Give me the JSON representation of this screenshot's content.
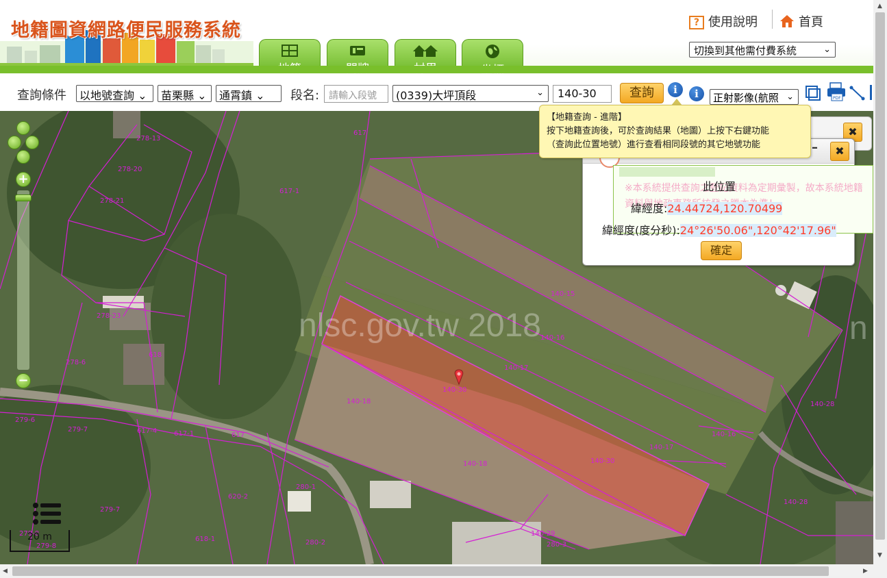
{
  "header": {
    "site_title": "地籍圖資網路便民服務系統",
    "help_label": "使用說明",
    "home_label": "首頁",
    "system_switch": "切換到其他需付費系統",
    "tabs": [
      {
        "label": "地籍",
        "icon": "parcel-grid-icon",
        "active": true
      },
      {
        "label": "門牌",
        "icon": "doorplate-icon",
        "active": false
      },
      {
        "label": "村里",
        "icon": "village-houses-icon",
        "active": false
      },
      {
        "label": "坐標",
        "icon": "globe-icon",
        "active": false
      }
    ]
  },
  "query": {
    "condition_label": "查詢條件",
    "mode": "以地號查詢",
    "county": "苗栗縣",
    "town": "通霄鎮",
    "section_label": "段名:",
    "section_placeholder": "請輸入段號",
    "section": "(0339)大坪頂段",
    "parcel_no": "140-30",
    "search_label": "查詢",
    "basemap": "正射影像(航照"
  },
  "tooltip": {
    "title": "【地籍查詢 - 進階】",
    "line1": "按下地籍查詢後，可於查詢結果（地圖）上按下右鍵功能",
    "line2": "（查詢此位置地號）進行查看相同段號的其它地號功能"
  },
  "position_popup": {
    "notice": "※本系統提供查詢之登記資料為定期彙製，故本系統地籍資料與地政事務所核發之謄本為準！",
    "title": "此位置",
    "latlon_label": "緯經度:",
    "latlon_value": "24.44724,120.70499",
    "dms_label": "緯經度(度分秒):",
    "dms_value": "24°26'50.06\",120°42'17.96\"",
    "confirm_label": "確定"
  },
  "map": {
    "watermark": "nlsc.gov.tw 2018",
    "watermark_tail": "n",
    "scale_label": "20 m",
    "highlight_parcel": "140-30",
    "parcel_labels": [
      "278-13",
      "278-20",
      "278-21",
      "617",
      "617-1",
      "278-23",
      "278-6",
      "618",
      "279-6",
      "279-7",
      "617-1",
      "617",
      "620-2",
      "280-1",
      "279-7",
      "618-1",
      "280-2",
      "279-8",
      "279-8",
      "140-15",
      "140-16",
      "140-17",
      "140-18",
      "140-30",
      "140-18",
      "140-30",
      "140-16",
      "140-17",
      "140-28",
      "140-28",
      "140-29",
      "280-3",
      "140-1",
      "617-4"
    ]
  },
  "colors": {
    "accent_green": "#79bf2b",
    "title_orange": "#d9541c",
    "parcel_line": "#d41fd4",
    "highlight": "#e0503c",
    "coord_value": "#ff3d2a"
  }
}
